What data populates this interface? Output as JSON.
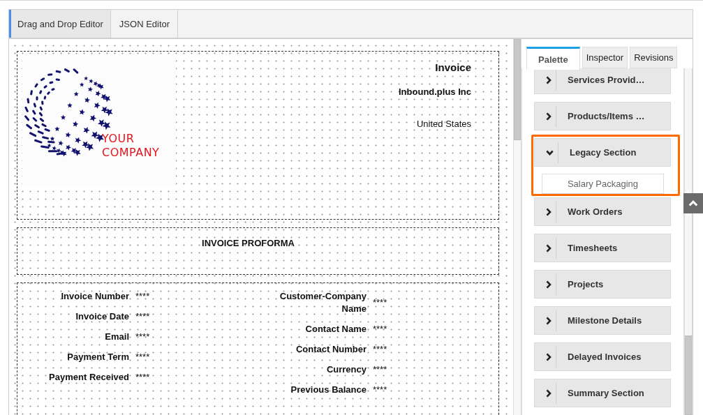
{
  "editor_tabs": [
    {
      "label": "Drag and Drop Editor",
      "selected": true
    },
    {
      "label": "JSON Editor",
      "selected": false
    }
  ],
  "invoice": {
    "logo": {
      "wordmark_lines": [
        "YOUR",
        "COMPANY"
      ]
    },
    "title": "Invoice",
    "company": "Inbound.plus Inc",
    "country": "United States",
    "banner": "INVOICE PROFORMA",
    "fields_left": [
      {
        "label": "Invoice Number",
        "value": "****"
      },
      {
        "label": "Invoice Date",
        "value": "****"
      },
      {
        "label": "Email",
        "value": "****"
      },
      {
        "label": "Payment Term",
        "value": "****"
      },
      {
        "label": "Payment Received",
        "value": "****"
      }
    ],
    "fields_right": [
      {
        "label": "Customer-Company Name",
        "value": "****"
      },
      {
        "label": "Contact Name",
        "value": "****"
      },
      {
        "label": "Contact Number",
        "value": "****"
      },
      {
        "label": "Currency",
        "value": "****"
      },
      {
        "label": "Previous Balance",
        "value": "****"
      }
    ]
  },
  "side_tabs": [
    {
      "label": "Palette",
      "selected": true
    },
    {
      "label": "Inspector",
      "selected": false
    },
    {
      "label": "Revisions",
      "selected": false
    }
  ],
  "palette_sections": [
    {
      "title": "Services Provid…",
      "expanded": false,
      "highlighted": false
    },
    {
      "title": "Products/Items …",
      "expanded": false,
      "highlighted": false
    },
    {
      "title": "Legacy Section",
      "expanded": true,
      "highlighted": true,
      "children": [
        {
          "label": "Salary Packaging"
        }
      ]
    },
    {
      "title": "Work Orders",
      "expanded": false,
      "highlighted": false
    },
    {
      "title": "Timesheets",
      "expanded": false,
      "highlighted": false
    },
    {
      "title": "Projects",
      "expanded": false,
      "highlighted": false
    },
    {
      "title": "Milestone Details",
      "expanded": false,
      "highlighted": false
    },
    {
      "title": "Delayed Invoices",
      "expanded": false,
      "highlighted": false
    },
    {
      "title": "Summary Section",
      "expanded": false,
      "highlighted": false
    }
  ]
}
